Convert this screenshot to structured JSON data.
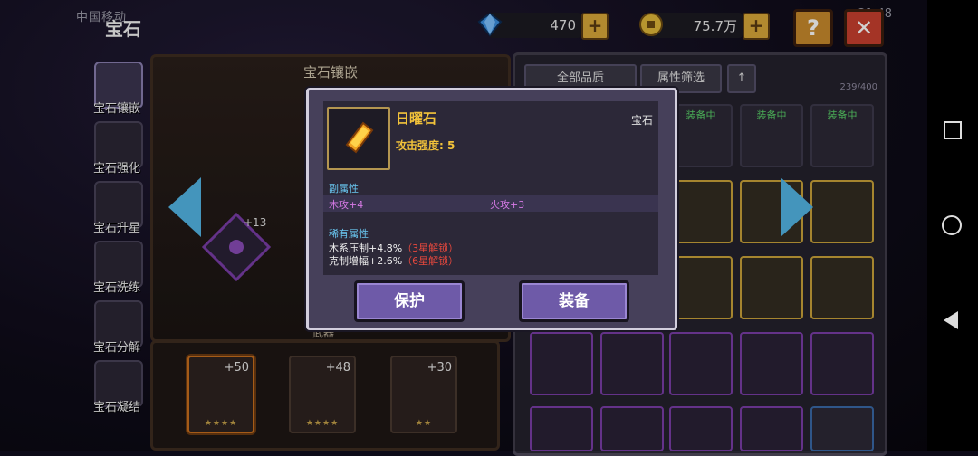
{
  "status": {
    "carrier": "中国移动",
    "time": "21:48",
    "battery": "53"
  },
  "header": {
    "title": "宝石",
    "help_label": "?",
    "close_label": "✕"
  },
  "resources": {
    "diamond": {
      "value": "470",
      "icon": "diamond-icon"
    },
    "gold": {
      "value": "75.7万",
      "icon": "coin-icon"
    }
  },
  "sidebar": {
    "items": [
      {
        "label": "宝石镶嵌",
        "icon": "gem-inlay-icon"
      },
      {
        "label": "宝石强化",
        "icon": "gem-enhance-icon"
      },
      {
        "label": "宝石升星",
        "icon": "gem-star-icon"
      },
      {
        "label": "宝石洗练",
        "icon": "gem-refine-icon"
      },
      {
        "label": "宝石分解",
        "icon": "gem-decompose-icon"
      },
      {
        "label": "宝石凝结",
        "icon": "gem-condense-icon"
      }
    ]
  },
  "center": {
    "title": "宝石镶嵌",
    "socket_level": "+13",
    "weapon_label": "武器"
  },
  "equipment": [
    {
      "level": "+50",
      "stars": "★★★★"
    },
    {
      "level": "+48",
      "stars": "★★★★"
    },
    {
      "level": "+30",
      "stars": "★★"
    }
  ],
  "inventory": {
    "filter_quality": "全部品质",
    "filter_attr": "属性筛选",
    "sort_icon": "arrow-up-icon",
    "count": "239/400",
    "equipped_tag": "装备中"
  },
  "modal": {
    "name": "日曜石",
    "type": "宝石",
    "attack": "攻击强度: 5",
    "sub_title": "副属性",
    "sub_attrs": [
      "木攻+4",
      "火攻+3"
    ],
    "rare_title": "稀有属性",
    "rare_attrs": [
      {
        "text": "木系压制+4.8%",
        "lock": "（3星解锁）"
      },
      {
        "text": "克制增幅+2.6%",
        "lock": "（6星解锁）"
      }
    ],
    "protect_label": "保护",
    "equip_label": "装备"
  },
  "colors": {
    "accent_gold": "#f3c33a",
    "sub_attr": "#d77ae6",
    "section": "#69c6f0",
    "lock": "#e8483d",
    "button": "#6e5aa8"
  }
}
